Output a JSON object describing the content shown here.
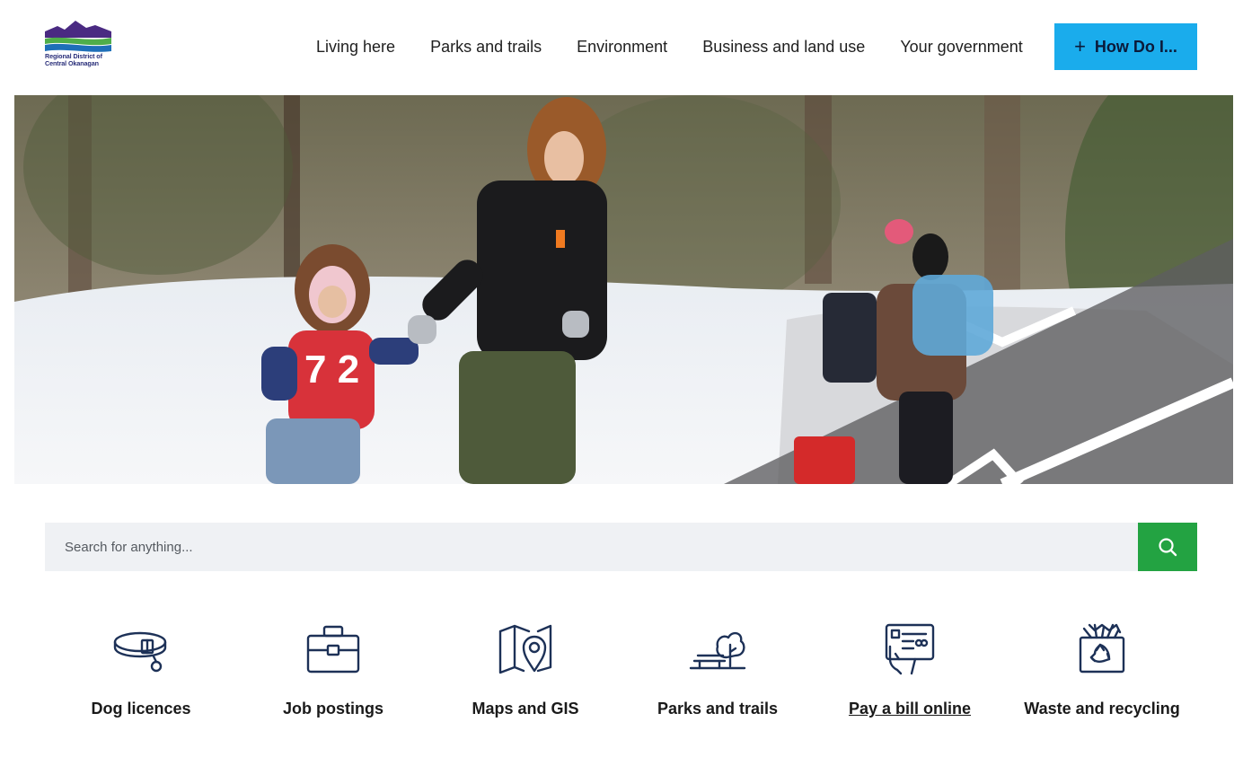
{
  "brand": {
    "name_line1": "Regional District of",
    "name_line2": "Central Okanagan",
    "colors": {
      "purple": "#4a2a82",
      "green": "#4fae4a",
      "blue": "#1e6fb8"
    }
  },
  "nav": {
    "items": [
      {
        "label": "Living here"
      },
      {
        "label": "Parks and trails"
      },
      {
        "label": "Environment"
      },
      {
        "label": "Business and land use"
      },
      {
        "label": "Your government"
      }
    ],
    "how_do_i": {
      "icon": "plus-icon",
      "label": "How Do I..."
    }
  },
  "search": {
    "placeholder": "Search for anything...",
    "button_icon": "search-icon",
    "button_color": "#23a342"
  },
  "quick_links": [
    {
      "label": "Dog licences",
      "icon": "dog-collar-icon"
    },
    {
      "label": "Job postings",
      "icon": "briefcase-icon"
    },
    {
      "label": "Maps and GIS",
      "icon": "map-pin-icon"
    },
    {
      "label": "Parks and trails",
      "icon": "park-bench-tree-icon"
    },
    {
      "label": "Pay a bill online",
      "icon": "bill-payment-icon",
      "underlined": true
    },
    {
      "label": "Waste and recycling",
      "icon": "recycling-bin-icon"
    }
  ],
  "accent": {
    "how_button": "#1aacec",
    "icon_navy": "#1d3157"
  }
}
